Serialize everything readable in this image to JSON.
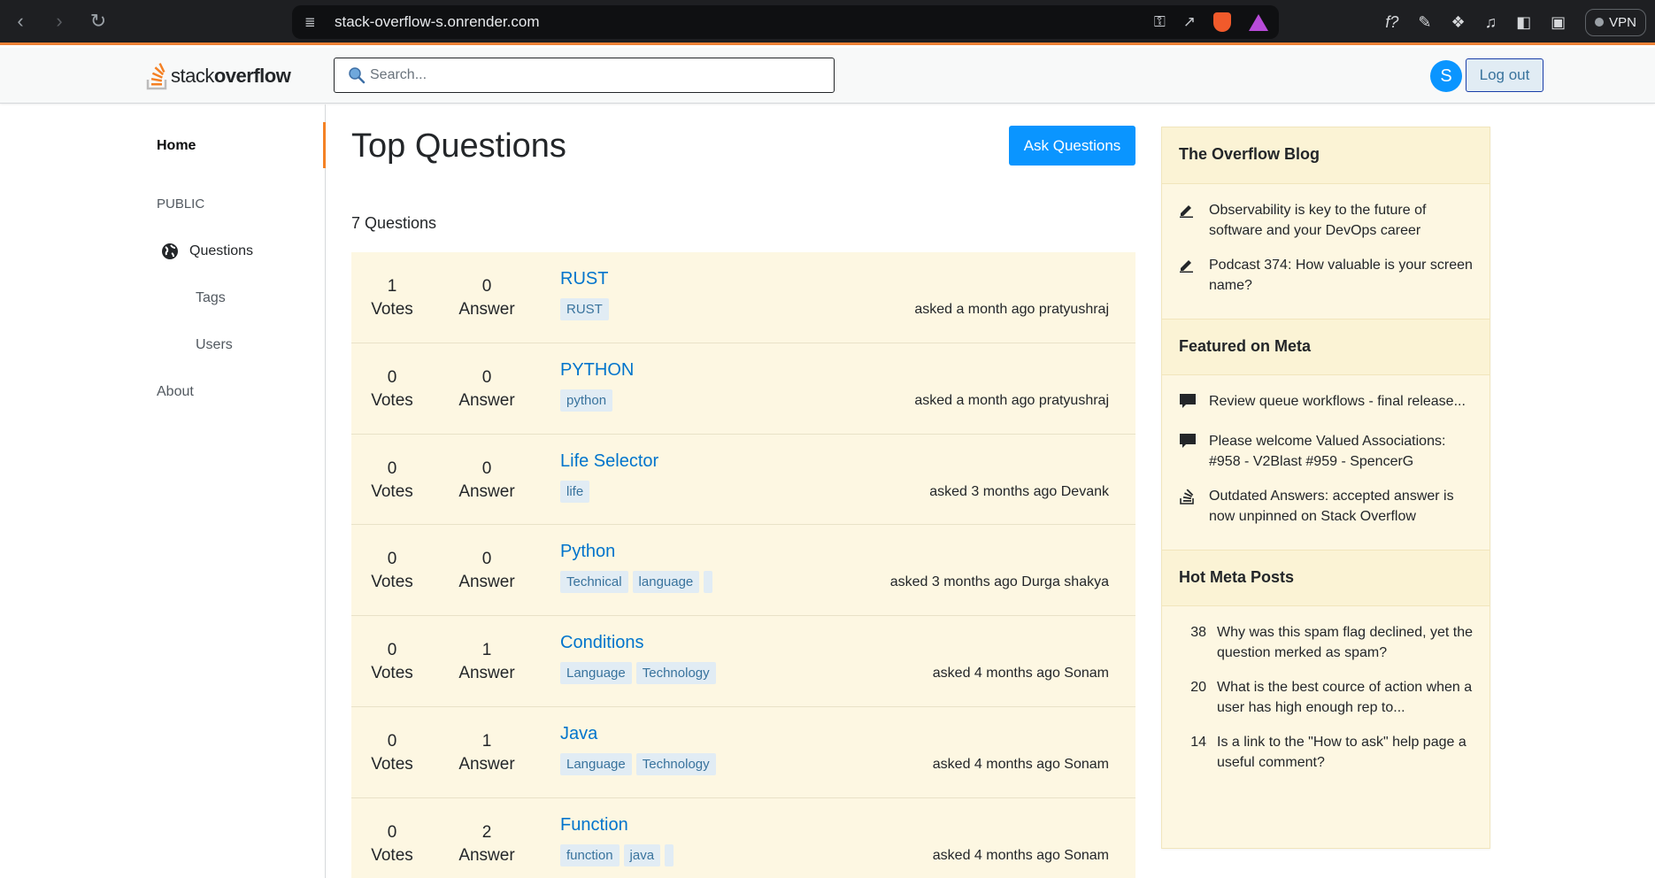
{
  "browser": {
    "url": "stack-overflow-s.onrender.com",
    "vpn_label": "VPN"
  },
  "header": {
    "logo_word1": "stack",
    "logo_word2": "overflow",
    "search_placeholder": "Search...",
    "avatar_initial": "S",
    "logout_label": "Log out"
  },
  "sidebar": {
    "home": "Home",
    "public": "PUBLIC",
    "questions": "Questions",
    "tags": "Tags",
    "users": "Users",
    "about": "About"
  },
  "main": {
    "title": "Top Questions",
    "ask_button": "Ask Questions",
    "count": "7 Questions",
    "questions": [
      {
        "votes": "1",
        "votes_label": "Votes",
        "answers": "0",
        "answers_label": "Answer",
        "title": "RUST",
        "tags": [
          "RUST"
        ],
        "asked": "asked a month ago pratyushraj"
      },
      {
        "votes": "0",
        "votes_label": "Votes",
        "answers": "0",
        "answers_label": "Answer",
        "title": "PYTHON",
        "tags": [
          "python"
        ],
        "asked": "asked a month ago pratyushraj"
      },
      {
        "votes": "0",
        "votes_label": "Votes",
        "answers": "0",
        "answers_label": "Answer",
        "title": "Life Selector",
        "tags": [
          "life"
        ],
        "asked": "asked 3 months ago Devank"
      },
      {
        "votes": "0",
        "votes_label": "Votes",
        "answers": "0",
        "answers_label": "Answer",
        "title": "Python",
        "tags": [
          "Technical",
          "language",
          ""
        ],
        "asked": "asked 3 months ago Durga shakya"
      },
      {
        "votes": "0",
        "votes_label": "Votes",
        "answers": "1",
        "answers_label": "Answer",
        "title": "Conditions",
        "tags": [
          "Language",
          "Technology"
        ],
        "asked": "asked 4 months ago Sonam"
      },
      {
        "votes": "0",
        "votes_label": "Votes",
        "answers": "1",
        "answers_label": "Answer",
        "title": "Java",
        "tags": [
          "Language",
          "Technology"
        ],
        "asked": "asked 4 months ago Sonam"
      },
      {
        "votes": "0",
        "votes_label": "Votes",
        "answers": "2",
        "answers_label": "Answer",
        "title": "Function",
        "tags": [
          "function",
          "java",
          ""
        ],
        "asked": "asked 4 months ago Sonam"
      }
    ]
  },
  "right": {
    "blog_title": "The Overflow Blog",
    "blog": [
      "Observability is key to the future of software and your DevOps career",
      "Podcast 374: How valuable is your screen name?"
    ],
    "meta_title": "Featured on Meta",
    "meta": [
      "Review queue workflows - final release...",
      "Please welcome Valued Associations: #958 - V2Blast #959 - SpencerG",
      "Outdated Answers: accepted answer is now unpinned on Stack Overflow"
    ],
    "hot_title": "Hot Meta Posts",
    "hot": [
      {
        "count": "38",
        "text": "Why was this spam flag declined, yet the question merked as spam?"
      },
      {
        "count": "20",
        "text": "What is the best cource of action when a user has high enough rep to..."
      },
      {
        "count": "14",
        "text": "Is a link to the \"How to ask\" help page a useful comment?"
      }
    ]
  }
}
